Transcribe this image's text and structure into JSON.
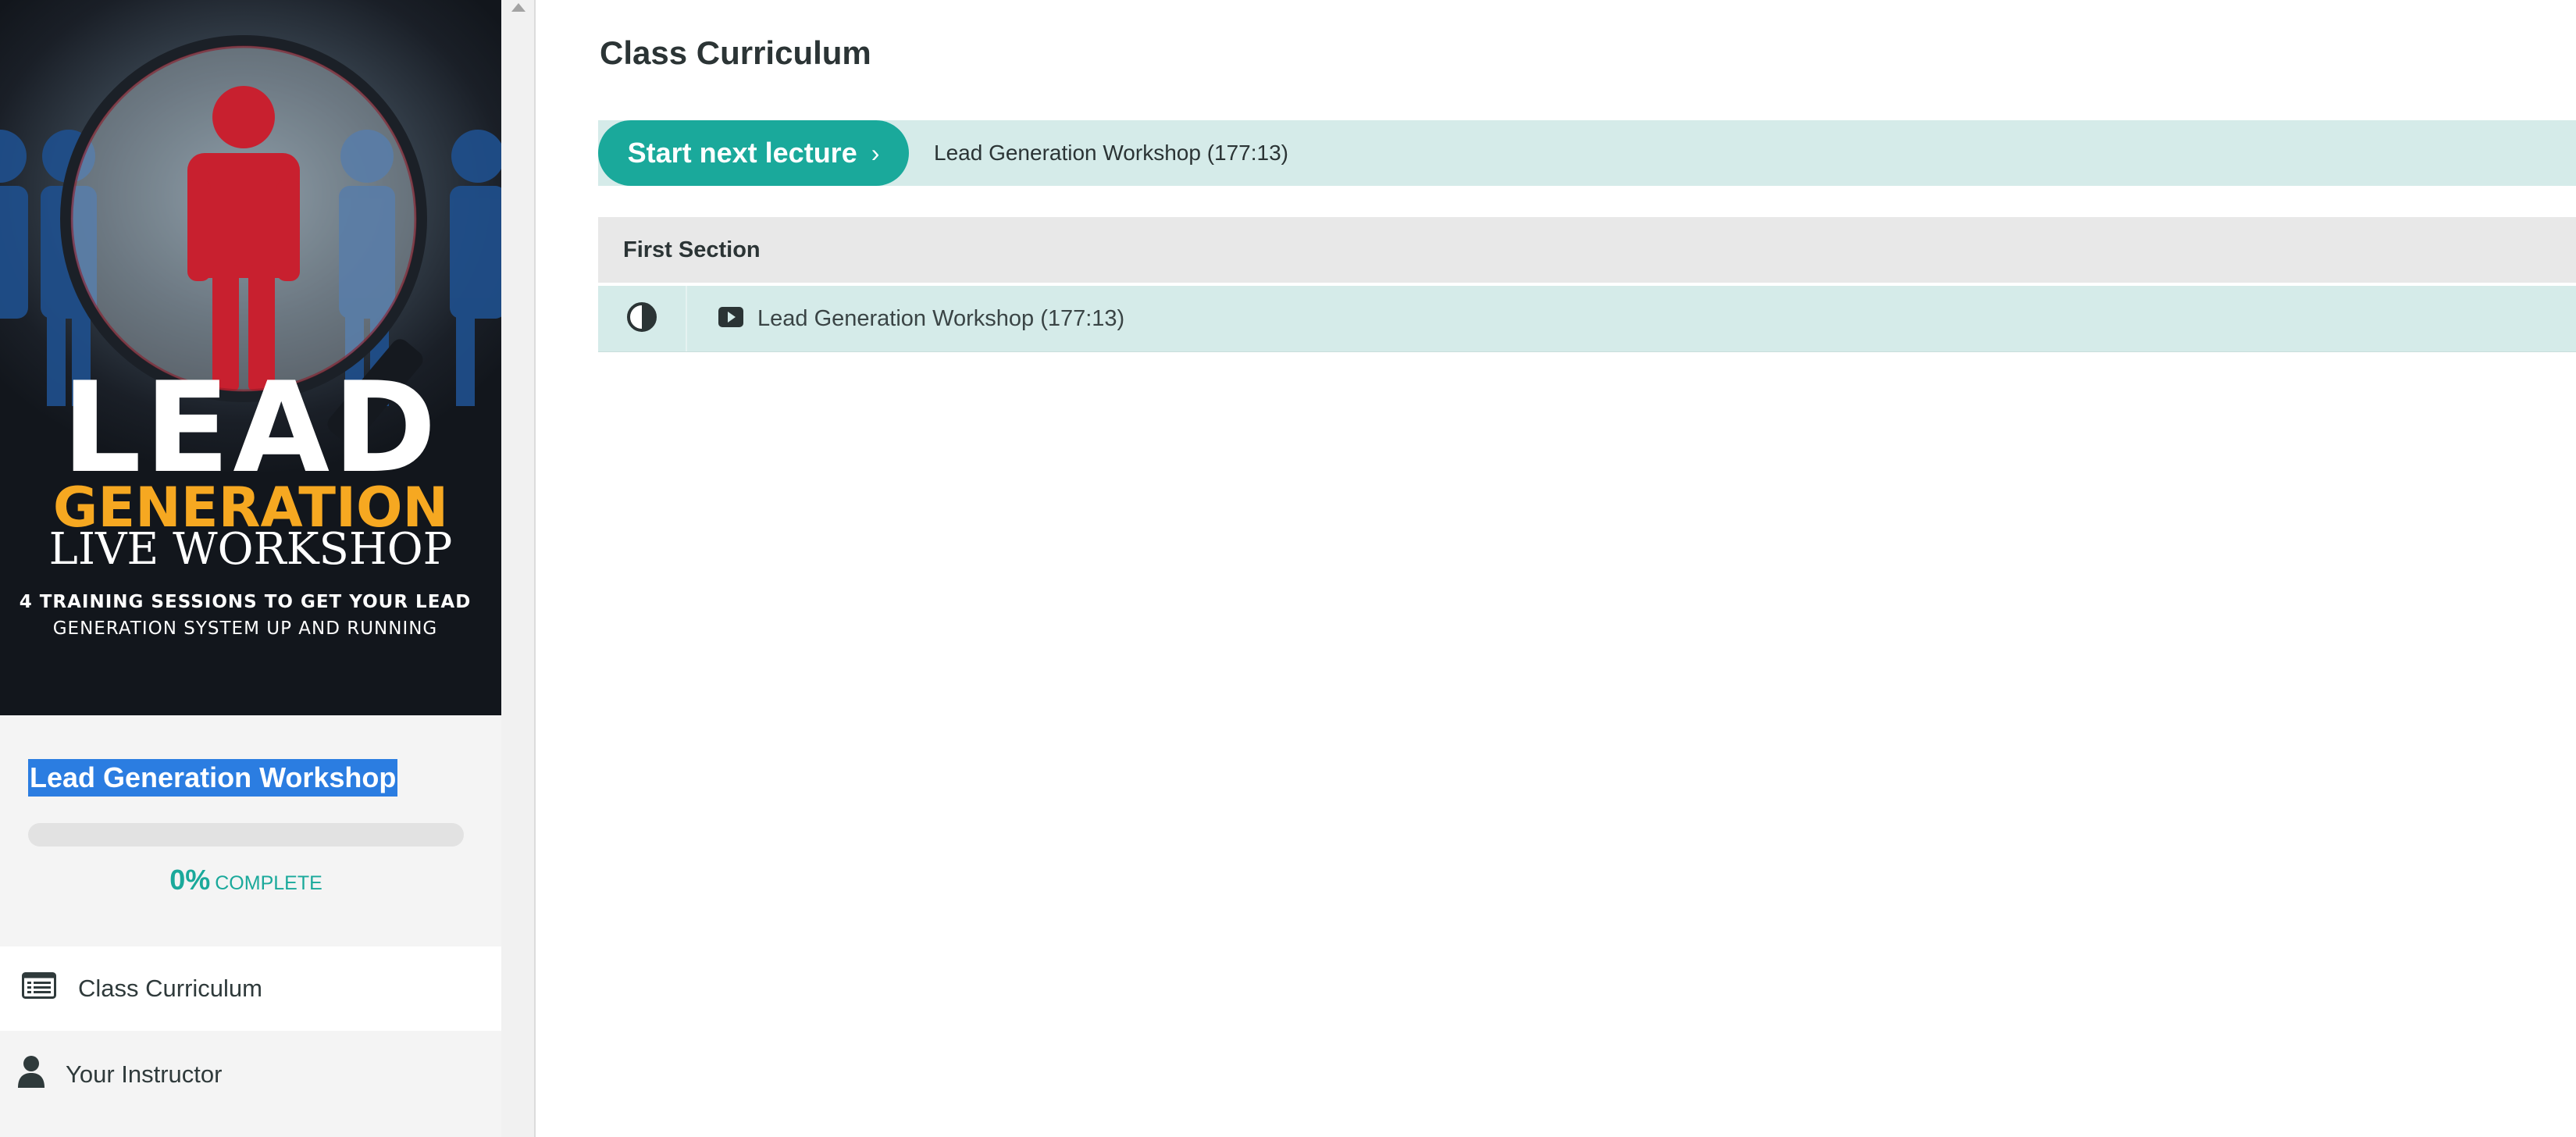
{
  "sidebar": {
    "cover": {
      "line1": "LEAD",
      "line2": "GENERATION",
      "line3": "LIVE WORKSHOP",
      "tagline1": "4 TRAINING SESSIONS TO GET YOUR LEAD",
      "tagline2": "GENERATION SYSTEM UP AND RUNNING"
    },
    "course_title": "Lead Generation Workshop",
    "progress": {
      "percent_value": 0,
      "percent_label": "0%",
      "label": "COMPLETE"
    },
    "nav": [
      {
        "label": "Class Curriculum",
        "icon": "list-icon",
        "active": true
      },
      {
        "label": "Your Instructor",
        "icon": "user-icon",
        "active": false
      }
    ]
  },
  "main": {
    "title": "Class Curriculum",
    "next_button_label": "Start next lecture",
    "next_button_chevron": "›",
    "next_lecture": "Lead Generation Workshop (177:13)",
    "sections": [
      {
        "title": "First Section",
        "lectures": [
          {
            "name": "Lead Generation Workshop (177:13)",
            "status_icon": "half-circle-icon",
            "type_icon": "youtube-play-icon"
          }
        ]
      }
    ]
  },
  "colors": {
    "accent": "#1aa99b",
    "row_highlight": "#d5ebe9",
    "section_header": "#e8e8e8",
    "selection": "#2b7de1",
    "cover_orange": "#f6a821",
    "figure_red": "#c8202f",
    "figure_blue": "#1f4f8c"
  }
}
